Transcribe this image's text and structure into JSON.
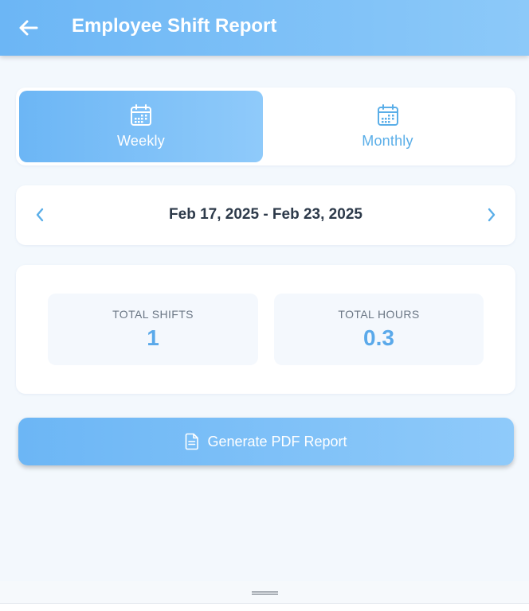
{
  "header": {
    "title": "Employee Shift Report",
    "back_icon": "arrow-left-icon",
    "background": "#6cb6f5"
  },
  "period_toggle": {
    "options": [
      {
        "label": "Weekly",
        "icon": "calendar-icon",
        "selected": true
      },
      {
        "label": "Monthly",
        "icon": "calendar-icon",
        "selected": false
      }
    ]
  },
  "date_range": {
    "text": "Feb 17, 2025 - Feb 23, 2025",
    "prev_icon": "chevron-left-icon",
    "next_icon": "chevron-right-icon"
  },
  "stats": {
    "total_shifts": {
      "label": "TOTAL SHIFTS",
      "value": "1"
    },
    "total_hours": {
      "label": "TOTAL HOURS",
      "value": "0.3"
    }
  },
  "actions": {
    "generate_pdf": {
      "label": "Generate PDF Report",
      "icon": "document-icon"
    }
  },
  "colors": {
    "accent": "#6cb6f5",
    "accent_light": "#8fcafa",
    "value_text": "#5aa9ea",
    "page_bg": "#f3f8fd"
  }
}
